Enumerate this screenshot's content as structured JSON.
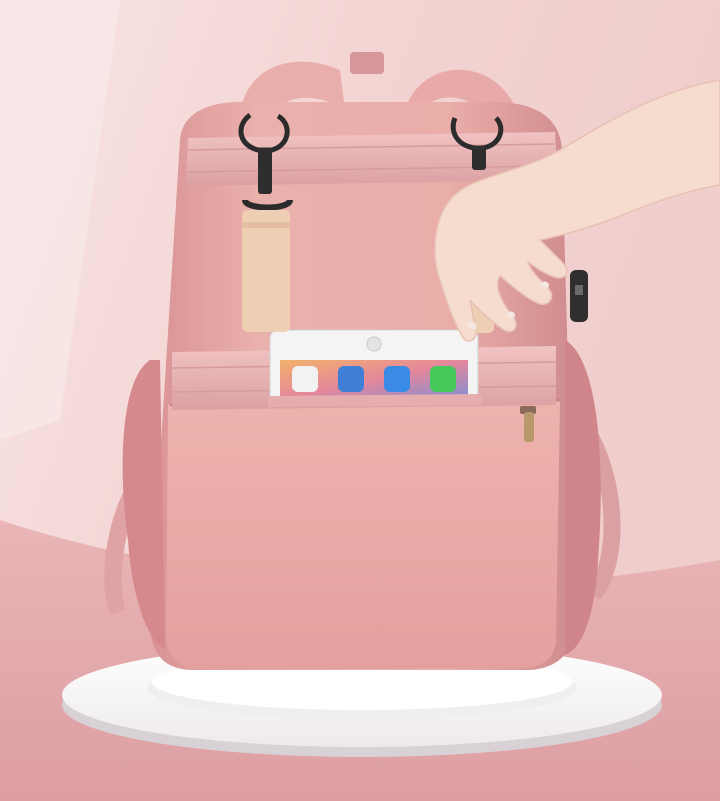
{
  "scene": {
    "subject": "backpack",
    "colors": {
      "background_light": "#f7e3e2",
      "background_wall": "#eec7c5",
      "floor": "#e3a9ac",
      "bag_body": "#e8a9a6",
      "bag_shadow": "#c9878a",
      "strap": "#e6b3b4",
      "tag": "#efcfb3",
      "pedestal": "#ffffff",
      "hand": "#f5d9cf"
    },
    "tablet_apps": [
      {
        "icon": "music-app-icon",
        "color": "#f2f2f2"
      },
      {
        "icon": "mail-app-icon",
        "color": "#3f7fd6"
      },
      {
        "icon": "safari-app-icon",
        "color": "#3a8be6"
      },
      {
        "icon": "messages-app-icon",
        "color": "#46c85b"
      }
    ]
  }
}
